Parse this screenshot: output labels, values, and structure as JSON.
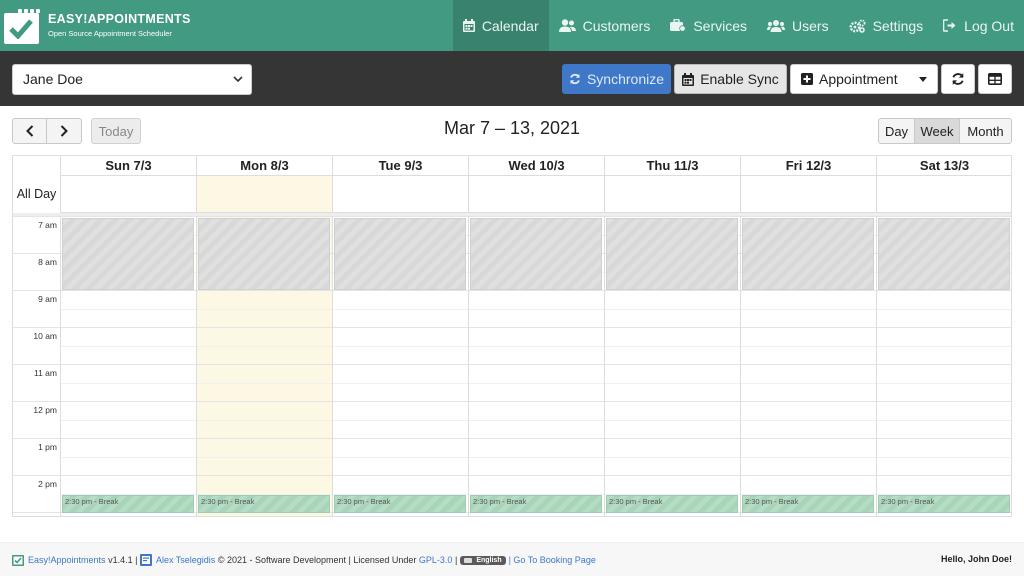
{
  "header": {
    "brand_title": "EASY!APPOINTMENTS",
    "brand_subtitle": "Open Source Appointment Scheduler",
    "nav": [
      {
        "label": "Calendar",
        "icon": "calendar-icon",
        "active": true
      },
      {
        "label": "Customers",
        "icon": "users-icon",
        "active": false
      },
      {
        "label": "Services",
        "icon": "briefcase-icon",
        "active": false
      },
      {
        "label": "Users",
        "icon": "user-group-icon",
        "active": false
      },
      {
        "label": "Settings",
        "icon": "cogs-icon",
        "active": false
      },
      {
        "label": "Log Out",
        "icon": "sign-out-icon",
        "active": false
      }
    ]
  },
  "toolbar": {
    "provider_select": "Jane Doe",
    "synchronize_label": "Synchronize",
    "enable_sync_label": "Enable Sync",
    "appointment_label": "Appointment",
    "reload_icon": "reload-icon",
    "table_icon": "table-icon"
  },
  "calendar": {
    "today_label": "Today",
    "title": "Mar 7 – 13, 2021",
    "views": {
      "day": "Day",
      "week": "Week",
      "month": "Month",
      "active": "Week"
    },
    "all_day_label": "All Day",
    "days": [
      "Sun 7/3",
      "Mon 8/3",
      "Tue 9/3",
      "Wed 10/3",
      "Thu 11/3",
      "Fri 12/3",
      "Sat 13/3"
    ],
    "today_index": 1,
    "time_labels": [
      "7 am",
      "8 am",
      "9 am",
      "10 am",
      "11 am",
      "12 pm",
      "1 pm",
      "2 pm"
    ],
    "break_event_label": "2:30 pm - Break"
  },
  "footer": {
    "app_name": "Easy!Appointments",
    "version": "v1.4.1 |",
    "author": "Alex Tselegidis",
    "copyright": "© 2021 - Software Development | Licensed Under",
    "license": "GPL-3.0",
    "sep": "|",
    "language": "English",
    "booking_link": "| Go To Booking Page",
    "greeting": "Hello, John Doe!"
  },
  "colors": {
    "header_bg": "#429a82",
    "toolbar_bg": "#353535",
    "sync_button": "#3f77c9",
    "today_bg": "#fcf8e3",
    "break_bg": "#b5dcc4"
  }
}
